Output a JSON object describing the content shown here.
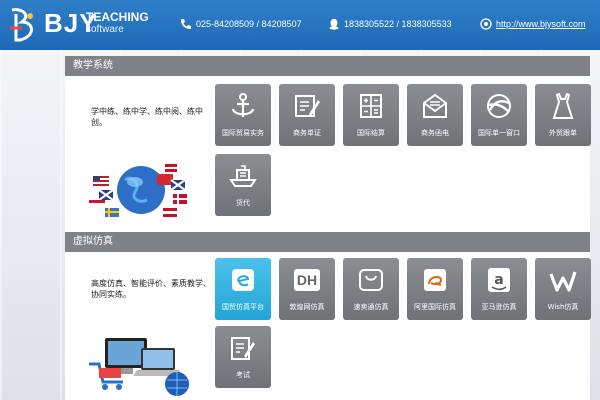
{
  "header": {
    "brand": "BJY",
    "teaching": "TEACHING",
    "software": "software",
    "phone": "025-84208509 / 84208507",
    "qq": "1838305522 / 1838305533",
    "website": "http://www.bjysoft.com"
  },
  "teaching_system": {
    "title": "教学系统",
    "intro": "学中练、练中学、练中阅、练中创。",
    "tiles": [
      {
        "label": "国际贸易实务",
        "icon": "anchor-icon"
      },
      {
        "label": "商务单证",
        "icon": "document-pen-icon"
      },
      {
        "label": "国际结算",
        "icon": "calculator-icon"
      },
      {
        "label": "商务函电",
        "icon": "envelope-icon"
      },
      {
        "label": "国际单一窗口",
        "icon": "single-window-icon"
      },
      {
        "label": "外贸跟单",
        "icon": "dress-icon"
      },
      {
        "label": "货代",
        "icon": "cargo-ship-icon"
      }
    ]
  },
  "virtual_sim": {
    "title": "虚拟仿真",
    "intro": "高度仿真、智能评价、素质教学、协同实练。",
    "tiles": [
      {
        "label": "国贸仿真平台",
        "icon": "trade-platform-icon"
      },
      {
        "label": "敦煌网仿真",
        "icon": "dh-icon",
        "text": "DH"
      },
      {
        "label": "速卖通仿真",
        "icon": "smile-bag-icon"
      },
      {
        "label": "阿里国际仿真",
        "icon": "alibaba-icon"
      },
      {
        "label": "亚马逊仿真",
        "icon": "amazon-icon"
      },
      {
        "label": "Wish仿真",
        "icon": "wish-icon"
      },
      {
        "label": "考试",
        "icon": "exam-pen-icon"
      }
    ]
  },
  "colors": {
    "header": "#2570bd",
    "panel_title": "#7f8388",
    "tile": "#7c7f83",
    "tile_active": "#32b2e1"
  }
}
